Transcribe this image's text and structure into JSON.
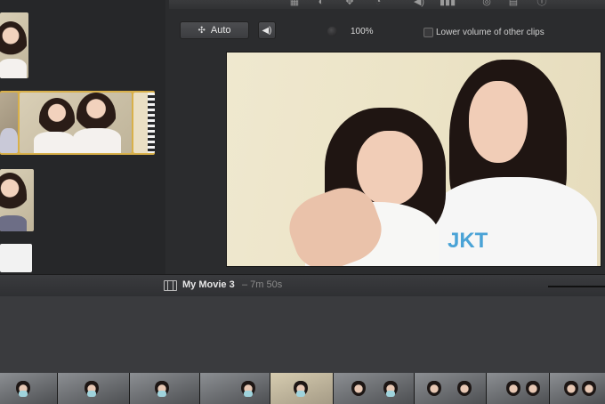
{
  "viewer_controls": {
    "auto_label": "Auto",
    "volume_percent": "100%",
    "lower_volume_label": "Lower volume of other clips"
  },
  "project": {
    "title": "My Movie 3",
    "duration": "– 7m 50s"
  },
  "viewer": {
    "shirt_logo": "JKT"
  },
  "icons": {
    "auto_icon": "magic-wand-icon",
    "volume_icon": "speaker-icon",
    "film_icon": "film-strip-icon"
  },
  "colors": {
    "selection": "#d8b04a",
    "background": "#2b2c2e"
  }
}
